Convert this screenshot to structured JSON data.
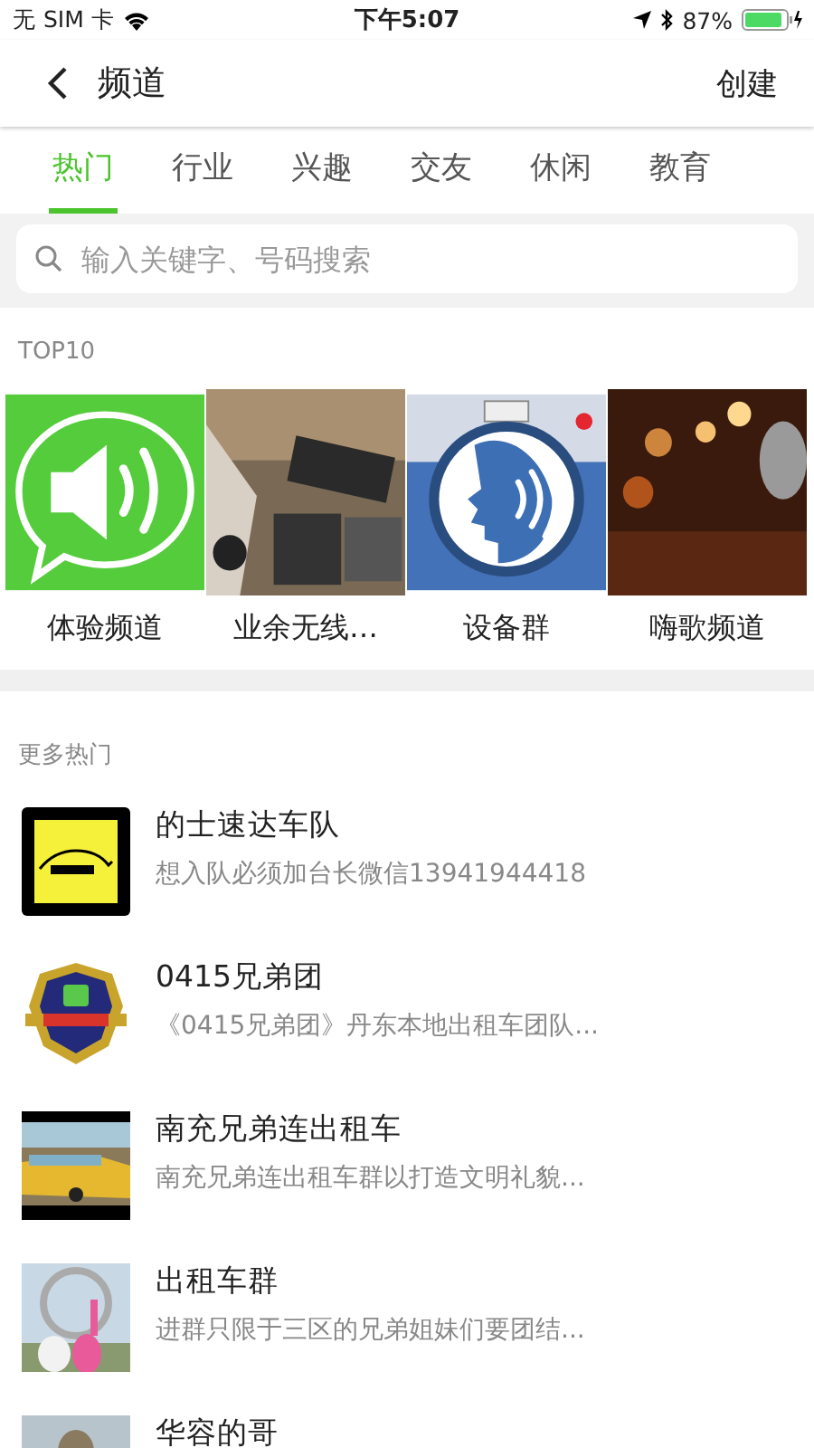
{
  "status_bar": {
    "carrier": "无 SIM 卡",
    "time": "下午5:07",
    "battery": "87%"
  },
  "nav": {
    "title": "频道",
    "action": "创建"
  },
  "tabs": [
    {
      "label": "热门",
      "selected": true
    },
    {
      "label": "行业",
      "selected": false
    },
    {
      "label": "兴趣",
      "selected": false
    },
    {
      "label": "交友",
      "selected": false
    },
    {
      "label": "休闲",
      "selected": false
    },
    {
      "label": "教育",
      "selected": false
    }
  ],
  "search": {
    "placeholder": "输入关键字、号码搜索"
  },
  "top10": {
    "title": "TOP10",
    "items": [
      {
        "kind": "speaker",
        "name": "体验频道"
      },
      {
        "kind": "picture",
        "name": "业余无线…"
      },
      {
        "kind": "voice",
        "name": "设备群"
      },
      {
        "kind": "picture",
        "name": "嗨歌频道"
      }
    ]
  },
  "more": {
    "title": "更多热门",
    "items": [
      {
        "kind": "taxi",
        "name": "的士速达车队",
        "desc": "想入队必须加台长微信13941944418"
      },
      {
        "kind": "badge",
        "name": "0415兄弟团",
        "desc": "《0415兄弟团》丹东本地出租车团队..."
      },
      {
        "kind": "picture",
        "name": "南充兄弟连出租车",
        "desc": "南充兄弟连出租车群以打造文明礼貌..."
      },
      {
        "kind": "picture",
        "name": "出租车群",
        "desc": "进群只限于三区的兄弟姐妹们要团结..."
      },
      {
        "kind": "picture",
        "name": "华容的哥"
      }
    ]
  }
}
